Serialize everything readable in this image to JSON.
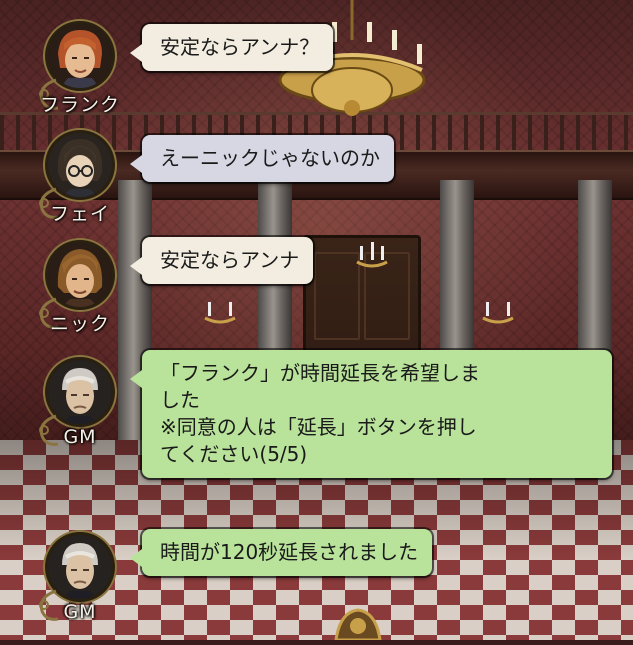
{
  "messages": [
    {
      "speaker": "フランク",
      "text": "安定ならアンナ？",
      "bubble_color": "#f2ede0",
      "avatar_icon": "frank-portrait-icon"
    },
    {
      "speaker": "フェイ",
      "text": "えーニックじゃないのか",
      "bubble_color": "#d7d7e3",
      "avatar_icon": "fei-portrait-icon"
    },
    {
      "speaker": "ニック",
      "text": "安定ならアンナ",
      "bubble_color": "#f2ede0",
      "avatar_icon": "nick-portrait-icon"
    },
    {
      "speaker": "GM",
      "text_lines": [
        "「フランク」が時間延長を希望しま",
        "した",
        "※同意の人は「延長」ボタンを押し",
        "てください(5/5)"
      ],
      "bubble_color": "#b9e29a",
      "avatar_icon": "gm-portrait-icon"
    },
    {
      "speaker": "GM",
      "text": "時間が120秒延長されました",
      "bubble_color": "#b9e29a",
      "avatar_icon": "gm-portrait-icon"
    }
  ]
}
